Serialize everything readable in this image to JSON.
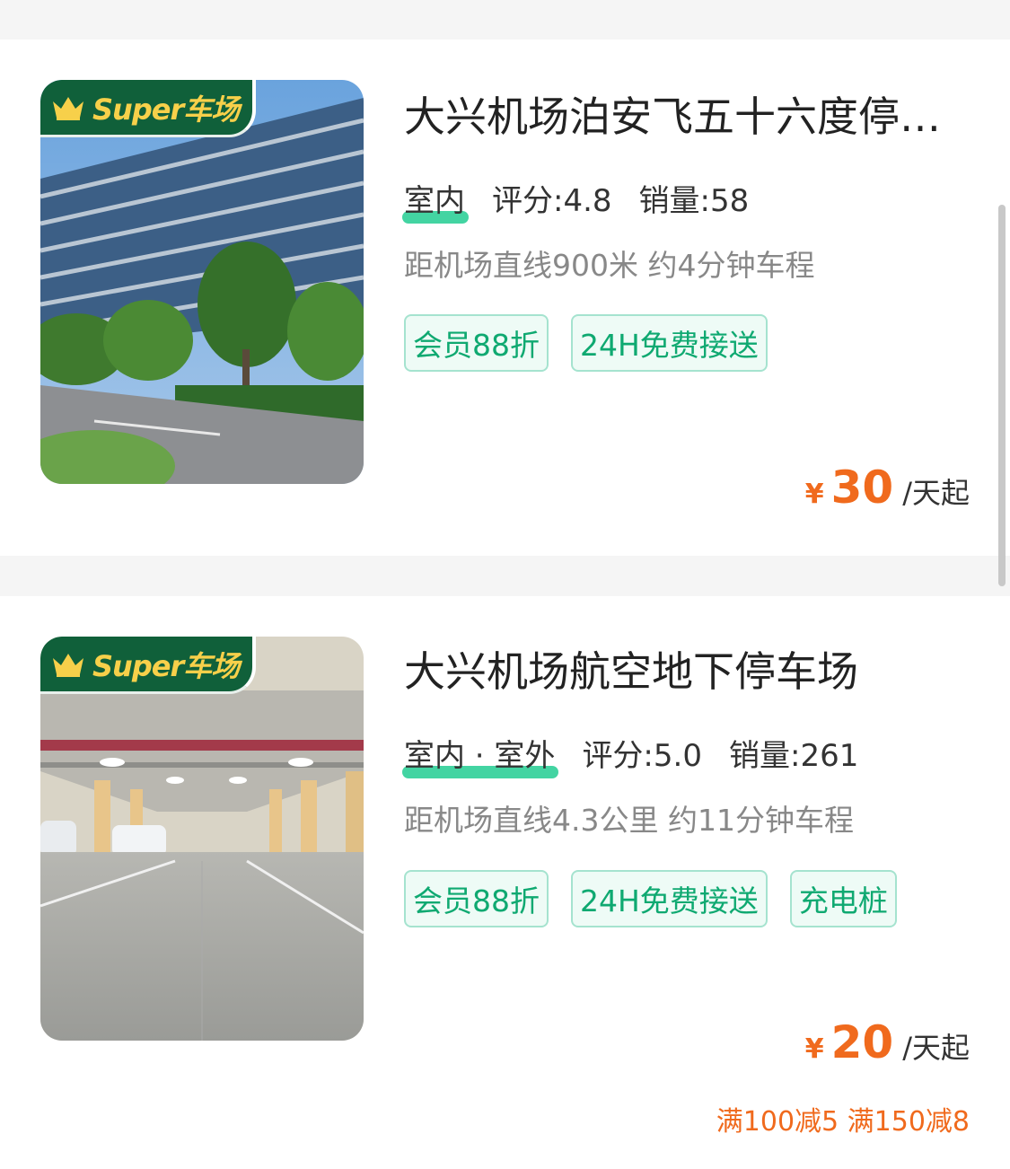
{
  "badge_text": "Super车场",
  "listings": [
    {
      "title": "大兴机场泊安飞五十六度停…",
      "environment": "室内",
      "rating_label": "评分:",
      "rating": "4.8",
      "sales_label": "销量:",
      "sales": "58",
      "distance": "距机场直线900米 约4分钟车程",
      "tags": [
        "会员88折",
        "24H免费接送"
      ],
      "currency": "¥",
      "price": "30",
      "price_unit": "/天起",
      "promo": ""
    },
    {
      "title": "大兴机场航空地下停车场",
      "environment": "室内 · 室外",
      "rating_label": "评分:",
      "rating": "5.0",
      "sales_label": "销量:",
      "sales": "261",
      "distance": "距机场直线4.3公里 约11分钟车程",
      "tags": [
        "会员88折",
        "24H免费接送",
        "充电桩"
      ],
      "currency": "¥",
      "price": "20",
      "price_unit": "/天起",
      "promo": "满100减5 满150减8"
    }
  ],
  "colors": {
    "accent_green": "#0fa971",
    "badge_green": "#10603a",
    "price_orange": "#f06a1d"
  }
}
